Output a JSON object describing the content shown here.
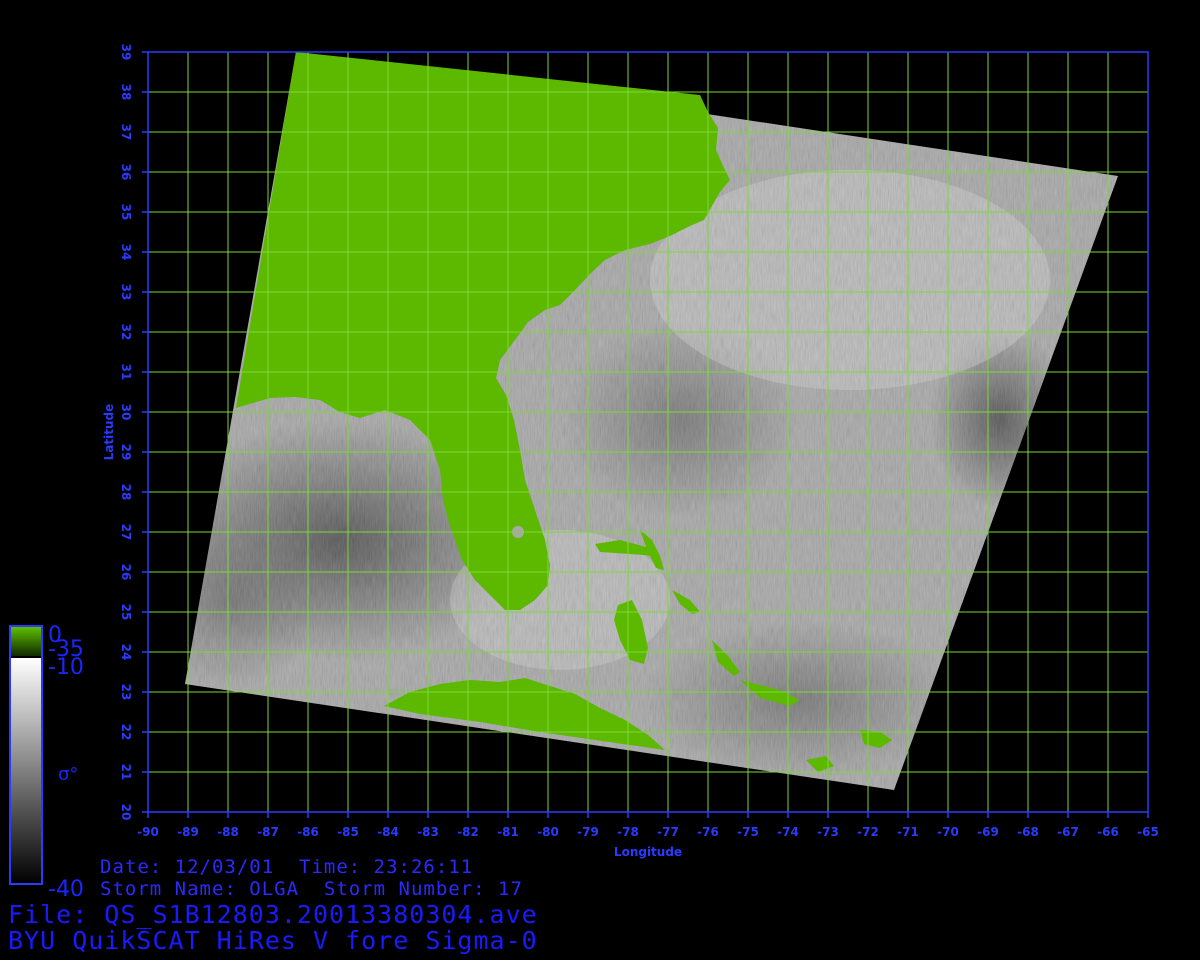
{
  "map": {
    "xlabel": "Longitude",
    "ylabel": "Latitude",
    "lon_range": [
      -90,
      -65
    ],
    "lat_range": [
      20,
      39
    ],
    "lon_ticks": [
      "-90",
      "-89",
      "-88",
      "-87",
      "-86",
      "-85",
      "-84",
      "-83",
      "-82",
      "-81",
      "-80",
      "-79",
      "-78",
      "-77",
      "-76",
      "-75",
      "-74",
      "-73",
      "-72",
      "-71",
      "-70",
      "-69",
      "-68",
      "-67",
      "-66",
      "-65"
    ],
    "lat_ticks": [
      "20",
      "21",
      "22",
      "23",
      "24",
      "25",
      "26",
      "27",
      "28",
      "29",
      "30",
      "31",
      "32",
      "33",
      "34",
      "35",
      "36",
      "37",
      "38",
      "39"
    ],
    "grid": true,
    "grid_color": "#7ed63a",
    "frame_color": "#2a3bff",
    "land_color": "#5db800",
    "swath_corners_lonlat": [
      [
        -86.2,
        38.9
      ],
      [
        -65.6,
        35.8
      ],
      [
        -71.2,
        20.5
      ],
      [
        -89.0,
        23.2
      ]
    ]
  },
  "colorbar": {
    "label": "σ°",
    "land_top": "0",
    "land_bottom": "-35",
    "top": "-10",
    "bottom": "-40"
  },
  "info": {
    "date_line": "Date: 12/03/01  Time: 23:26:11",
    "storm_line": "Storm Name: OLGA  Storm Number: 17",
    "file_line": "File: QS_S1B12803.20013380304.ave",
    "product_line": "BYU QuikSCAT HiRes V fore Sigma-0"
  },
  "colors": {
    "text_blue": "#1a26ff",
    "axis_blue": "#2a3bff"
  }
}
